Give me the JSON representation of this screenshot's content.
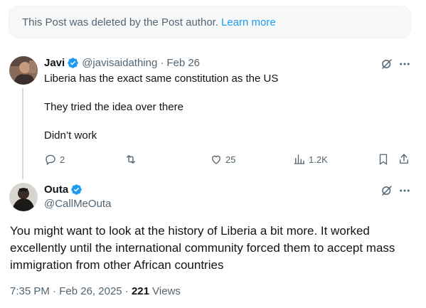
{
  "deleted_notice": {
    "text": "This Post was deleted by the Post author.",
    "link": "Learn more"
  },
  "reply_tweet": {
    "name": "Javi",
    "handle": "@javisaidathing",
    "separator": "·",
    "date": "Feb 26",
    "lines": [
      "Liberia has the exact same constitution as the US",
      "They tried the idea over there",
      "Didn’t work"
    ],
    "stats": {
      "replies": "2",
      "reposts": "",
      "likes": "25",
      "views": "1.2K"
    }
  },
  "main_tweet": {
    "name": "Outa",
    "handle": "@CallMeOuta",
    "text": "You might want to look at the history of Liberia a bit more. It worked excellently until the international community forced them to accept mass immigration from other African countries",
    "time": "7:35 PM",
    "date": "Feb 26, 2025",
    "separator": "·",
    "views_count": "221",
    "views_label": "Views"
  },
  "colors": {
    "accent": "#1d9bf0",
    "secondary_text": "#536471",
    "primary_text": "#0f1419"
  }
}
